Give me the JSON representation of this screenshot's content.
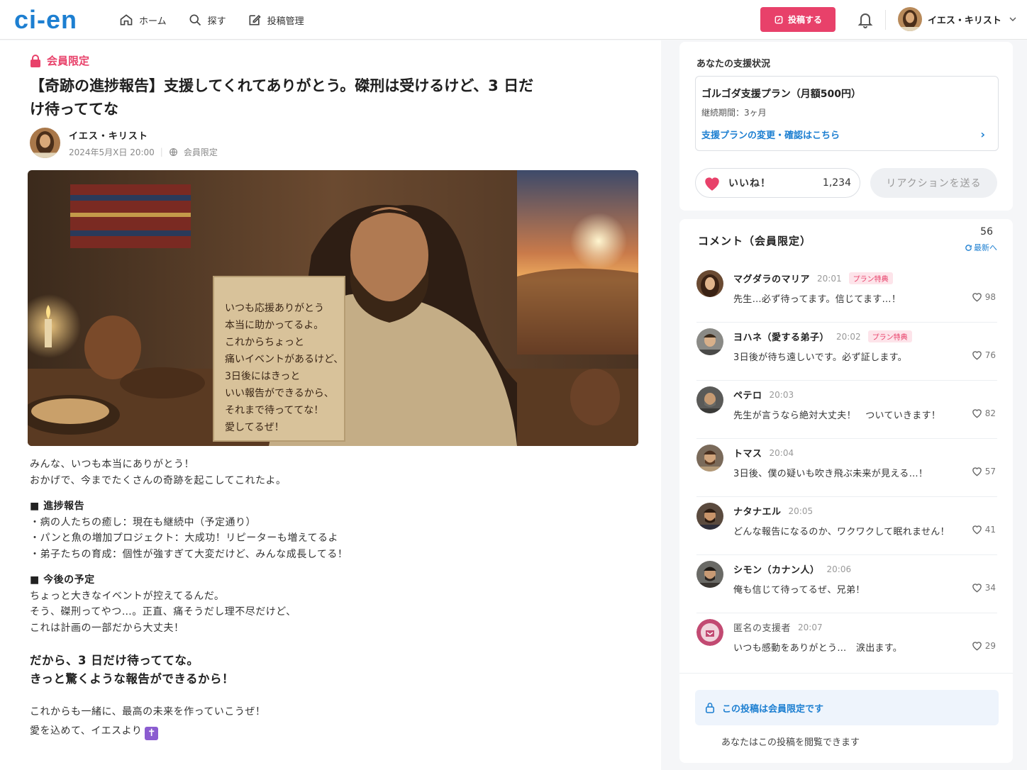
{
  "header": {
    "logo": "ci-en",
    "nav": [
      {
        "label": "ホーム",
        "icon": "home-icon"
      },
      {
        "label": "探す",
        "icon": "search-icon"
      },
      {
        "label": "投稿管理",
        "icon": "edit-icon"
      }
    ],
    "post_button": "投稿する",
    "user_name": "イエス・キリスト"
  },
  "post": {
    "badge": "会員限定",
    "title": "【奇跡の進捗報告】支援してくれてありがとう。磔刑は受けるけど、3 日だけ待っててな",
    "author": "イエス・キリスト",
    "date": "2024年5月X日 20:00",
    "visibility": "会員限定",
    "scroll_text": [
      "いつも応援ありがとう",
      "本当に助かってるよ。",
      "これからちょっと",
      "痛いイベントがあるけど、",
      "3日後にはきっと",
      "いい報告ができるから、",
      "それまで待っててな！",
      "愛してるぜ！"
    ],
    "body": {
      "intro1": "みんな、いつも本当にありがとう！",
      "intro2": "おかげで、今までたくさんの奇跡を起こしてこれたよ。",
      "sec1_title": "■ 進捗報告",
      "sec1_items": [
        "・病の人たちの癒し：現在も継続中（予定通り）",
        "・パンと魚の増加プロジェクト：大成功！リピーターも増えてるよ",
        "・弟子たちの育成：個性が強すぎて大変だけど、みんな成長してる！"
      ],
      "sec2_title": "■ 今後の予定",
      "sec2_lines": [
        "ちょっと大きなイベントが控えてるんだ。",
        "そう、磔刑ってやつ…。正直、痛そうだし理不尽だけど、",
        "これは計画の一部だから大丈夫！"
      ],
      "big1": "だから、3 日だけ待っててな。",
      "big2": "きっと驚くような報告ができるから！",
      "outro1": "これからも一緒に、最高の未来を作っていこうぜ！",
      "outro2": "愛を込めて、イエスより",
      "cross": "✝"
    }
  },
  "support": {
    "heading": "あなたの支援状況",
    "plan_name": "ゴルゴダ支援プラン（月額500円）",
    "duration": "継続期間：3ヶ月",
    "link": "支援プランの変更・確認はこちら",
    "like_label": "いいね！",
    "like_count": "1,234",
    "react_label": "リアクションを送る"
  },
  "comments": {
    "heading": "コメント（会員限定）",
    "count": "56",
    "latest": "最新へ",
    "items": [
      {
        "name": "マグダラのマリア",
        "time": "20:01",
        "badge": "プラン特典",
        "text": "先生…必ず待ってます。信じてます…！",
        "likes": "98"
      },
      {
        "name": "ヨハネ（愛する弟子）",
        "time": "20:02",
        "badge": "プラン特典",
        "text": "3日後が待ち遠しいです。必ず証します。",
        "likes": "76"
      },
      {
        "name": "ペテロ",
        "time": "20:03",
        "badge": "",
        "text": "先生が言うなら絶対大丈夫！　ついていきます！",
        "likes": "82"
      },
      {
        "name": "トマス",
        "time": "20:04",
        "badge": "",
        "text": "3日後、僕の疑いも吹き飛ぶ未来が見える…！",
        "likes": "57"
      },
      {
        "name": "ナタナエル",
        "time": "20:05",
        "badge": "",
        "text": "どんな報告になるのか、ワクワクして眠れません！",
        "likes": "41"
      },
      {
        "name": "シモン（カナン人）",
        "time": "20:06",
        "badge": "",
        "text": "俺も信じて待ってるぜ、兄弟！",
        "likes": "34"
      },
      {
        "name": "匿名の支援者",
        "time": "20:07",
        "badge": "",
        "text": "いつも感動をありがとう…　涙出ます。",
        "likes": "29"
      }
    ],
    "notice": "この投稿は会員限定です",
    "notice_sub": "あなたはこの投稿を閲覧できます"
  },
  "colors": {
    "accent": "#e8416a",
    "link": "#1d7fd1"
  }
}
